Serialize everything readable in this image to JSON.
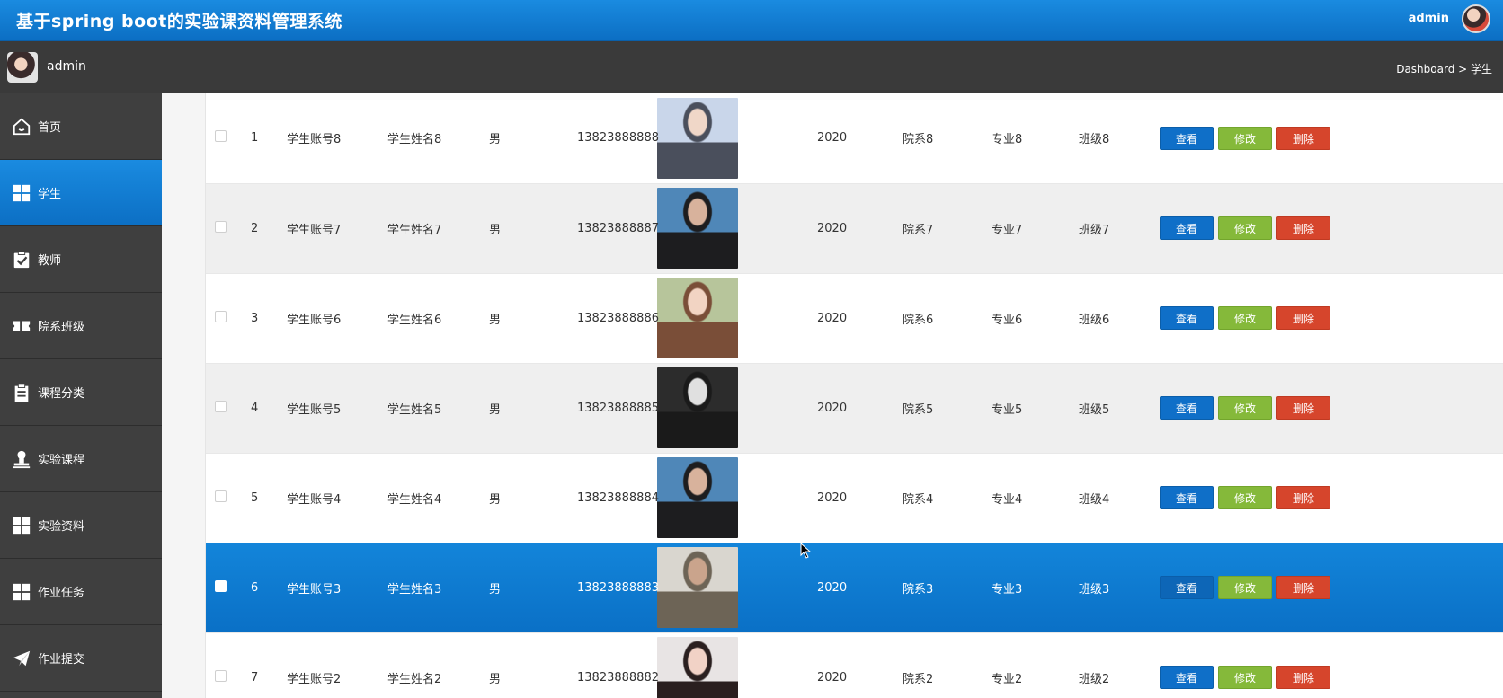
{
  "header": {
    "title": "基于spring boot的实验课资料管理系统",
    "user": "admin"
  },
  "subheader": {
    "user": "admin",
    "breadcrumb": "Dashboard > 学生"
  },
  "sidebar": {
    "items": [
      {
        "label": "首页",
        "icon": "home-icon"
      },
      {
        "label": "学生",
        "icon": "grid-icon",
        "active": true
      },
      {
        "label": "教师",
        "icon": "clipboard-check-icon"
      },
      {
        "label": "院系班级",
        "icon": "ticket-icon"
      },
      {
        "label": "课程分类",
        "icon": "document-icon"
      },
      {
        "label": "实验课程",
        "icon": "user-stamp-icon"
      },
      {
        "label": "实验资料",
        "icon": "grid-icon"
      },
      {
        "label": "作业任务",
        "icon": "grid-icon"
      },
      {
        "label": "作业提交",
        "icon": "send-icon"
      }
    ]
  },
  "actions": {
    "view": "查看",
    "edit": "修改",
    "delete": "删除"
  },
  "rows": [
    {
      "no": "1",
      "account": "学生账号8",
      "name": "学生姓名8",
      "gender": "男",
      "phone": "13823888888",
      "year": "2020",
      "dept": "院系8",
      "major": "专业8",
      "class": "班级8",
      "photo_colors": [
        "#c9d6ea",
        "#4a4f5c",
        "#f0d7c8"
      ]
    },
    {
      "no": "2",
      "account": "学生账号7",
      "name": "学生姓名7",
      "gender": "男",
      "phone": "13823888887",
      "year": "2020",
      "dept": "院系7",
      "major": "专业7",
      "class": "班级7",
      "photo_colors": [
        "#4f87b8",
        "#1d1d1f",
        "#d8b29c"
      ]
    },
    {
      "no": "3",
      "account": "学生账号6",
      "name": "学生姓名6",
      "gender": "男",
      "phone": "13823888886",
      "year": "2020",
      "dept": "院系6",
      "major": "专业6",
      "class": "班级6",
      "photo_colors": [
        "#b7c59b",
        "#7a4e38",
        "#f2d4c3"
      ]
    },
    {
      "no": "4",
      "account": "学生账号5",
      "name": "学生姓名5",
      "gender": "男",
      "phone": "13823888885",
      "year": "2020",
      "dept": "院系5",
      "major": "专业5",
      "class": "班级5",
      "photo_colors": [
        "#2c2c2c",
        "#1a1a1a",
        "#e0e0e0"
      ]
    },
    {
      "no": "5",
      "account": "学生账号4",
      "name": "学生姓名4",
      "gender": "男",
      "phone": "13823888884",
      "year": "2020",
      "dept": "院系4",
      "major": "专业4",
      "class": "班级4",
      "photo_colors": [
        "#4f87b8",
        "#1d1d1f",
        "#d8b29c"
      ]
    },
    {
      "no": "6",
      "account": "学生账号3",
      "name": "学生姓名3",
      "gender": "男",
      "phone": "13823888883",
      "year": "2020",
      "dept": "院系3",
      "major": "专业3",
      "class": "班级3",
      "photo_colors": [
        "#d9d6cf",
        "#6d6456",
        "#caa48c"
      ],
      "selected": true
    },
    {
      "no": "7",
      "account": "学生账号2",
      "name": "学生姓名2",
      "gender": "男",
      "phone": "13823888882",
      "year": "2020",
      "dept": "院系2",
      "major": "专业2",
      "class": "班级2",
      "photo_colors": [
        "#e8e4e4",
        "#2a1f1f",
        "#f1d2c6"
      ]
    }
  ]
}
